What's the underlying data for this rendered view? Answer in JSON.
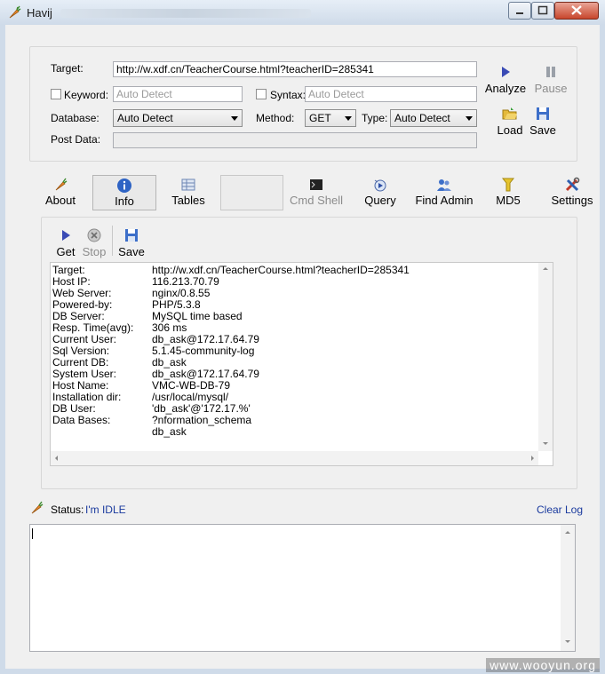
{
  "window": {
    "title": "Havij",
    "watermark": "www.wooyun.org"
  },
  "form": {
    "target_label": "Target:",
    "target_value": "http://w.xdf.cn/TeacherCourse.html?teacherID=285341",
    "keyword_label": "Keyword:",
    "keyword_placeholder": "Auto Detect",
    "syntax_label": "Syntax:",
    "syntax_placeholder": "Auto Detect",
    "database_label": "Database:",
    "database_value": "Auto Detect",
    "method_label": "Method:",
    "method_value": "GET",
    "type_label": "Type:",
    "type_value": "Auto Detect",
    "postdata_label": "Post Data:"
  },
  "actions": {
    "analyze": "Analyze",
    "pause": "Pause",
    "load": "Load",
    "save": "Save"
  },
  "tabs": {
    "about": "About",
    "info": "Info",
    "tables": "Tables",
    "cmd_shell": "Cmd Shell",
    "query": "Query",
    "find_admin": "Find Admin",
    "md5": "MD5",
    "settings": "Settings"
  },
  "info_toolbar": {
    "get": "Get",
    "stop": "Stop",
    "save": "Save"
  },
  "info": [
    {
      "key": "Target:",
      "value": "http://w.xdf.cn/TeacherCourse.html?teacherID=285341"
    },
    {
      "key": "Host IP:",
      "value": "116.213.70.79"
    },
    {
      "key": "Web Server:",
      "value": "nginx/0.8.55"
    },
    {
      "key": "Powered-by:",
      "value": "PHP/5.3.8"
    },
    {
      "key": "DB Server:",
      "value": "MySQL time based"
    },
    {
      "key": "Resp. Time(avg):",
      "value": "306 ms"
    },
    {
      "key": "Current User:",
      "value": "db_ask@172.17.64.79"
    },
    {
      "key": "Sql Version:",
      "value": "5.1.45-community-log"
    },
    {
      "key": "Current DB:",
      "value": "db_ask"
    },
    {
      "key": "System User:",
      "value": "db_ask@172.17.64.79"
    },
    {
      "key": "Host Name:",
      "value": "VMC-WB-DB-79"
    },
    {
      "key": "Installation dir:",
      "value": "/usr/local/mysql/"
    },
    {
      "key": "DB User:",
      "value": "'db_ask'@'172.17.%'"
    },
    {
      "key": "Data Bases:",
      "value": "?nformation_schema"
    },
    {
      "key": "",
      "value": "db_ask"
    }
  ],
  "status": {
    "label": "Status:",
    "value": "I'm IDLE",
    "clear_log": "Clear Log"
  },
  "colors": {
    "link": "#1a3a9e",
    "analyze_icon": "#3a4bb5",
    "status_text": "#1a3a9e"
  }
}
